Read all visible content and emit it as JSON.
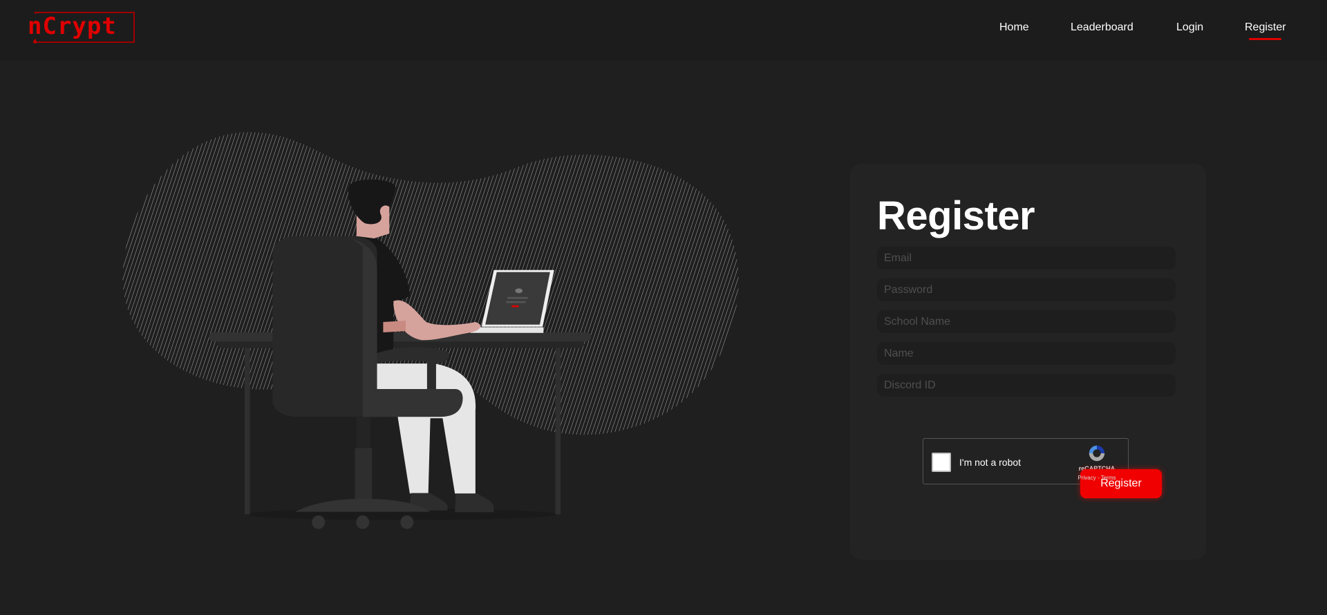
{
  "brand": {
    "logo_text": "nCrypt",
    "accent": "#e00000"
  },
  "nav": {
    "items": [
      {
        "label": "Home"
      },
      {
        "label": "Leaderboard"
      },
      {
        "label": "Login"
      },
      {
        "label": "Register",
        "active": true
      }
    ]
  },
  "form": {
    "title": "Register",
    "fields": [
      {
        "placeholder": "Email",
        "value": ""
      },
      {
        "placeholder": "Password",
        "value": ""
      },
      {
        "placeholder": "School Name",
        "value": ""
      },
      {
        "placeholder": "Name",
        "value": ""
      },
      {
        "placeholder": "Discord ID",
        "value": ""
      }
    ],
    "captcha": {
      "label": "I'm not a robot",
      "brand": "reCAPTCHA",
      "links": "Privacy - Terms",
      "checked": false
    },
    "submit_label": "Register"
  }
}
